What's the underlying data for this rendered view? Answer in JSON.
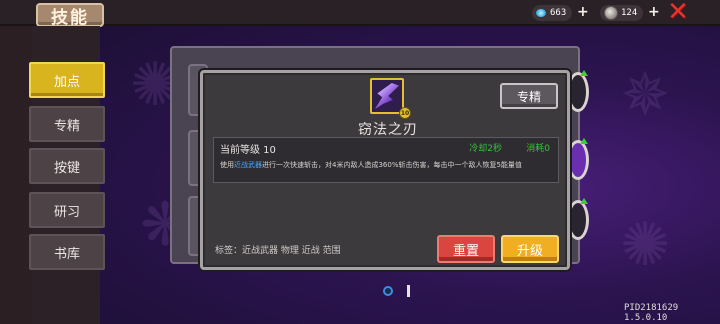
{
  "header": {
    "title": "技能",
    "gems": "663",
    "coins": "124"
  },
  "nav": {
    "items": [
      {
        "label": "加点"
      },
      {
        "label": "专精"
      },
      {
        "label": "按键"
      },
      {
        "label": "研习"
      },
      {
        "label": "书库"
      }
    ]
  },
  "modal": {
    "skill_name": "窃法之刃",
    "skill_level_badge": "10",
    "specialize_label": "专精",
    "level_text": "当前等级 10",
    "cooldown": "冷却2秒",
    "consume": "消耗0",
    "desc_prefix": "使用",
    "desc_keyword": "近战武器",
    "desc_rest": "进行一次快速斩击，对4米内敌人造成360%斩击伤害，每击中一个敌人恢复5能量值",
    "tags": "标签：近战武器 物理 近战 范围",
    "reset_label": "重置",
    "upgrade_label": "升级"
  },
  "footer": {
    "version": "PID2181629 1.5.0.10"
  },
  "colors": {
    "accent_gold": "#d8b41e",
    "reset_red": "#d9453f",
    "upgrade_orange": "#f0ae22",
    "green": "#36c43a",
    "keyword_blue": "#49a6ff"
  }
}
